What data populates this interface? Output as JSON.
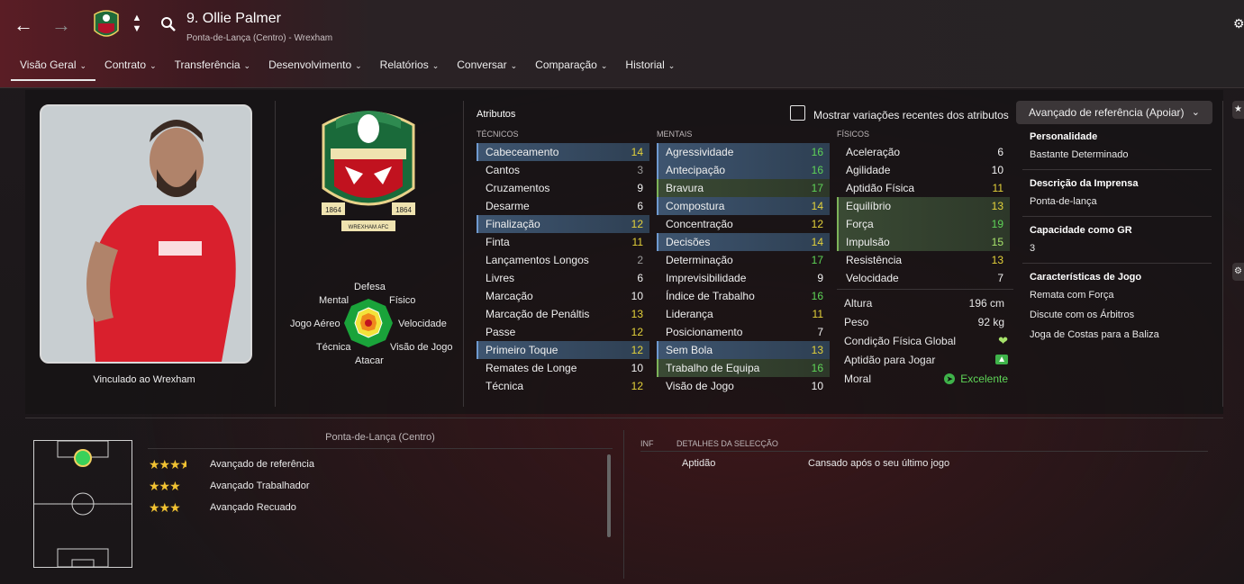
{
  "header": {
    "player_name": "9. Ollie Palmer",
    "player_sub": "Ponta-de-Lança (Centro) - Wrexham",
    "tabs": [
      {
        "label": "Visão Geral"
      },
      {
        "label": "Contrato"
      },
      {
        "label": "Transferência"
      },
      {
        "label": "Desenvolvimento"
      },
      {
        "label": "Relatórios"
      },
      {
        "label": "Conversar"
      },
      {
        "label": "Comparação"
      },
      {
        "label": "Historial"
      }
    ]
  },
  "profile": {
    "contract_label": "Vinculado ao Wrexham",
    "crest_text_left": "1864",
    "crest_text_right": "1864",
    "crest_banner": "WREXHAM AFC"
  },
  "radar": {
    "labels": {
      "top": "Defesa",
      "top_left": "Mental",
      "top_right": "Físico",
      "left": "Jogo Aéreo",
      "right": "Velocidade",
      "bottom_left": "Técnica",
      "bottom_right": "Visão de Jogo",
      "bottom": "Atacar"
    }
  },
  "attributes": {
    "title": "Atributos",
    "toggle_label": "Mostrar variações recentes dos atributos",
    "role_select": "Avançado de referência (Apoiar)",
    "technical_head": "TÉCNICOS",
    "mental_head": "MENTAIS",
    "physical_head": "FÍSICOS",
    "technical": [
      {
        "name": "Cabeceamento",
        "value": "14",
        "hl": "blue"
      },
      {
        "name": "Cantos",
        "value": "3",
        "hl": ""
      },
      {
        "name": "Cruzamentos",
        "value": "9",
        "hl": ""
      },
      {
        "name": "Desarme",
        "value": "6",
        "hl": ""
      },
      {
        "name": "Finalização",
        "value": "12",
        "hl": "blue"
      },
      {
        "name": "Finta",
        "value": "11",
        "hl": ""
      },
      {
        "name": "Lançamentos Longos",
        "value": "2",
        "hl": ""
      },
      {
        "name": "Livres",
        "value": "6",
        "hl": ""
      },
      {
        "name": "Marcação",
        "value": "10",
        "hl": ""
      },
      {
        "name": "Marcação de Penáltis",
        "value": "13",
        "hl": ""
      },
      {
        "name": "Passe",
        "value": "12",
        "hl": ""
      },
      {
        "name": "Primeiro Toque",
        "value": "12",
        "hl": "blue"
      },
      {
        "name": "Remates de Longe",
        "value": "10",
        "hl": ""
      },
      {
        "name": "Técnica",
        "value": "12",
        "hl": ""
      }
    ],
    "mental": [
      {
        "name": "Agressividade",
        "value": "16",
        "hl": "blue"
      },
      {
        "name": "Antecipação",
        "value": "16",
        "hl": "blue"
      },
      {
        "name": "Bravura",
        "value": "17",
        "hl": "green"
      },
      {
        "name": "Compostura",
        "value": "14",
        "hl": "blue"
      },
      {
        "name": "Concentração",
        "value": "12",
        "hl": ""
      },
      {
        "name": "Decisões",
        "value": "14",
        "hl": "blue"
      },
      {
        "name": "Determinação",
        "value": "17",
        "hl": ""
      },
      {
        "name": "Imprevisibilidade",
        "value": "9",
        "hl": ""
      },
      {
        "name": "Índice de Trabalho",
        "value": "16",
        "hl": ""
      },
      {
        "name": "Liderança",
        "value": "11",
        "hl": ""
      },
      {
        "name": "Posicionamento",
        "value": "7",
        "hl": ""
      },
      {
        "name": "Sem Bola",
        "value": "13",
        "hl": "blue"
      },
      {
        "name": "Trabalho de Equipa",
        "value": "16",
        "hl": "green"
      },
      {
        "name": "Visão de Jogo",
        "value": "10",
        "hl": ""
      }
    ],
    "physical": [
      {
        "name": "Aceleração",
        "value": "6",
        "hl": ""
      },
      {
        "name": "Agilidade",
        "value": "10",
        "hl": ""
      },
      {
        "name": "Aptidão Física",
        "value": "11",
        "hl": ""
      },
      {
        "name": "Equilíbrio",
        "value": "13",
        "hl": "green"
      },
      {
        "name": "Força",
        "value": "19",
        "hl": "green"
      },
      {
        "name": "Impulsão",
        "value": "15",
        "hl": "green"
      },
      {
        "name": "Resistência",
        "value": "13",
        "hl": ""
      },
      {
        "name": "Velocidade",
        "value": "7",
        "hl": ""
      }
    ],
    "extra": {
      "height_label": "Altura",
      "height_value": "196 cm",
      "weight_label": "Peso",
      "weight_value": "92 kg",
      "condition_label": "Condição Física Global",
      "sharpness_label": "Aptidão para Jogar",
      "morale_label": "Moral",
      "morale_value": "Excelente"
    }
  },
  "info": {
    "personality_head": "Personalidade",
    "personality": "Bastante Determinado",
    "press_head": "Descrição da Imprensa",
    "press": "Ponta-de-lança",
    "gk_head": "Capacidade como GR",
    "gk": "3",
    "traits_head": "Características de Jogo",
    "traits": [
      "Remata com Força",
      "Discute com os Árbitros",
      "Joga de Costas para a Baliza"
    ]
  },
  "positions": {
    "title": "Ponta-de-Lança (Centro)",
    "roles": [
      {
        "label": "Avançado de referência",
        "stars": 3.5
      },
      {
        "label": "Avançado Trabalhador",
        "stars": 3
      },
      {
        "label": "Avançado Recuado",
        "stars": 3
      }
    ]
  },
  "selection": {
    "inf_head": "INF",
    "details_head": "DETALHES DA SELECÇÃO",
    "row_label": "Aptidão",
    "row_value": "Cansado após o seu último jogo"
  },
  "colors": {
    "highlight_blue": "#3e5570",
    "highlight_green": "#3a4a34",
    "value_green": "#5ed457",
    "value_yellow": "#e4d23a",
    "club_red": "#b3122a"
  }
}
